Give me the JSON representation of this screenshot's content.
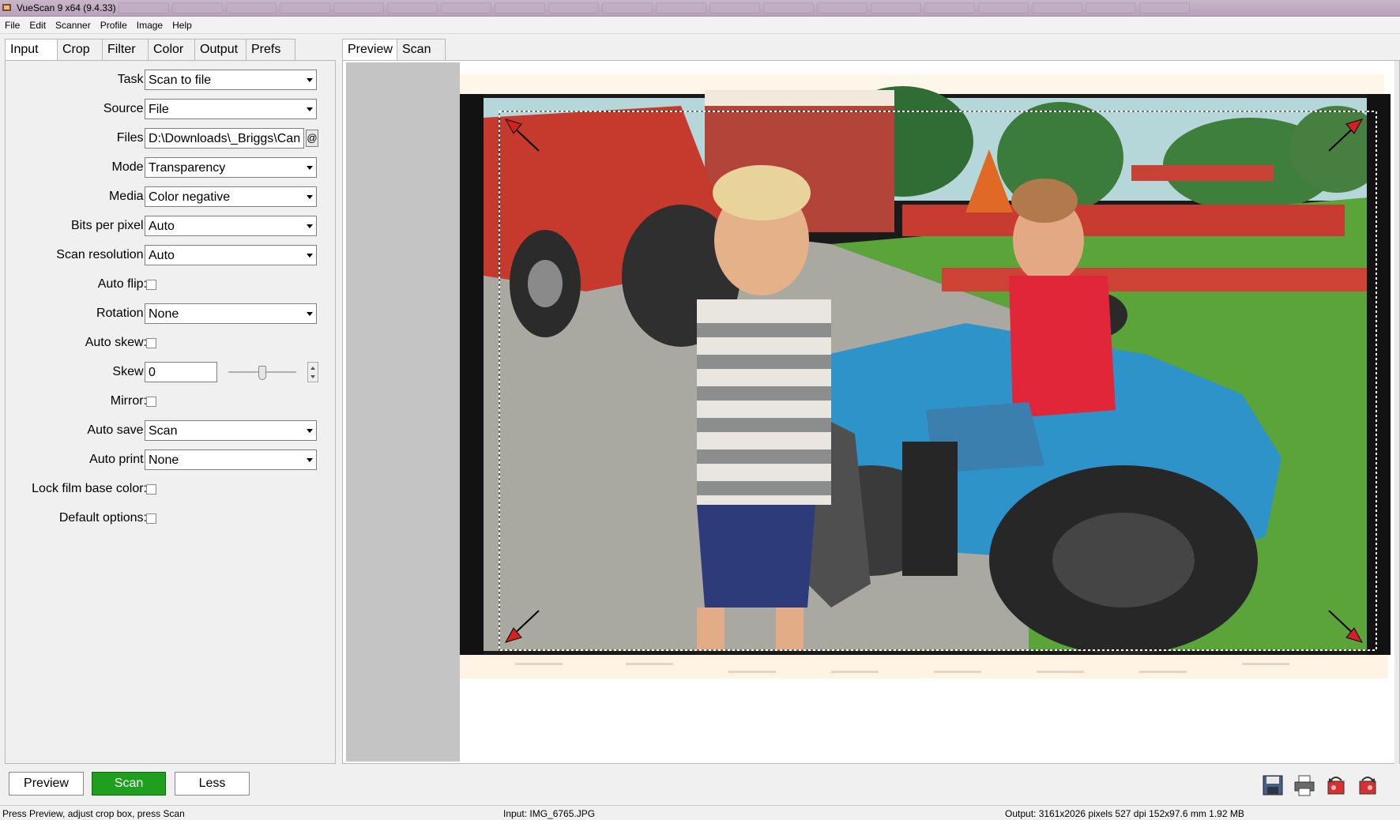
{
  "window": {
    "title": "VueScan 9 x64 (9.4.33)"
  },
  "menu": [
    "File",
    "Edit",
    "Scanner",
    "Profile",
    "Image",
    "Help"
  ],
  "left_tabs": [
    {
      "label": "Input",
      "active": true
    },
    {
      "label": "Crop",
      "active": false
    },
    {
      "label": "Filter",
      "active": false
    },
    {
      "label": "Color",
      "active": false
    },
    {
      "label": "Output",
      "active": false
    },
    {
      "label": "Prefs",
      "active": false
    }
  ],
  "input_options": {
    "task": {
      "label": "Task:",
      "value": "Scan to file"
    },
    "source": {
      "label": "Source:",
      "value": "File"
    },
    "files": {
      "label": "Files:",
      "value": "D:\\Downloads\\_Briggs\\Can",
      "browse": "@"
    },
    "mode": {
      "label": "Mode:",
      "value": "Transparency"
    },
    "media": {
      "label": "Media:",
      "value": "Color negative"
    },
    "bits_per_pixel": {
      "label": "Bits per pixel:",
      "value": "Auto"
    },
    "scan_resolution": {
      "label": "Scan resolution:",
      "value": "Auto"
    },
    "auto_flip": {
      "label": "Auto flip:",
      "checked": false
    },
    "rotation": {
      "label": "Rotation:",
      "value": "None"
    },
    "auto_skew": {
      "label": "Auto skew:",
      "checked": false
    },
    "skew": {
      "label": "Skew:",
      "value": "0"
    },
    "mirror": {
      "label": "Mirror:",
      "checked": false
    },
    "auto_save": {
      "label": "Auto save:",
      "value": "Scan"
    },
    "auto_print": {
      "label": "Auto print:",
      "value": "None"
    },
    "lock_film_base_color": {
      "label": "Lock film base color:",
      "checked": false
    },
    "default_options": {
      "label": "Default options:",
      "checked": false
    }
  },
  "right_tabs": [
    {
      "label": "Preview",
      "active": true
    },
    {
      "label": "Scan",
      "active": false
    }
  ],
  "buttons": {
    "preview": "Preview",
    "scan": "Scan",
    "less": "Less"
  },
  "status": {
    "hint": "Press Preview, adjust crop box, press Scan",
    "input": "Input: IMG_6765.JPG",
    "output": "Output: 3161x2026 pixels 527 dpi 152x97.6 mm 1.92 MB"
  },
  "colors": {
    "scan_button": "#1ea01e",
    "crop_arrows": "#d42020"
  }
}
